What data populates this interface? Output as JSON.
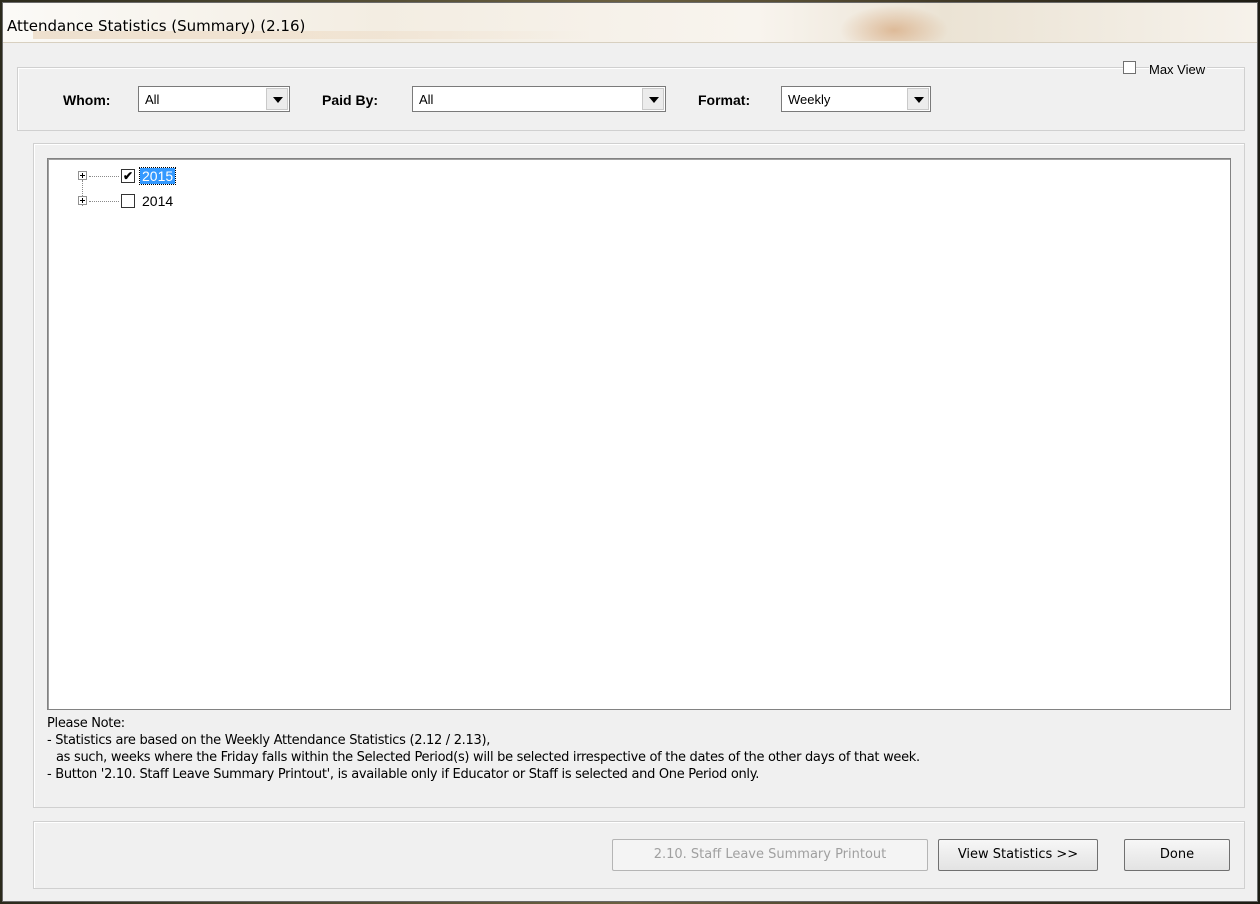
{
  "window": {
    "title": "Attendance Statistics (Summary) (2.16)"
  },
  "filters": {
    "whom": {
      "label": "Whom:",
      "value": "All"
    },
    "paid_by": {
      "label": "Paid By:",
      "value": "All"
    },
    "format": {
      "label": "Format:",
      "value": "Weekly"
    },
    "max_view": {
      "label": "Max View",
      "checked": false
    }
  },
  "tree": {
    "nodes": [
      {
        "label": "2015",
        "checked": true,
        "selected": true,
        "check_glyph": "✔"
      },
      {
        "label": "2014",
        "checked": false,
        "selected": false,
        "check_glyph": ""
      }
    ]
  },
  "notes": {
    "heading": "Please Note:",
    "line1": "- Statistics are based on the Weekly Attendance Statistics (2.12 / 2.13),",
    "line2": "as such, weeks where the Friday falls within the Selected Period(s) will be selected irrespective of the dates of the other days of that week.",
    "line3": "- Button '2.10.  Staff Leave Summary Printout', is available only if Educator or Staff is selected and One Period only."
  },
  "buttons": {
    "staff_leave": "2.10.  Staff Leave Summary Printout",
    "view_statistics": "View Statistics >>",
    "done": "Done"
  },
  "colors": {
    "selection": "#3399ff",
    "window_bg": "#f0f0f0"
  }
}
